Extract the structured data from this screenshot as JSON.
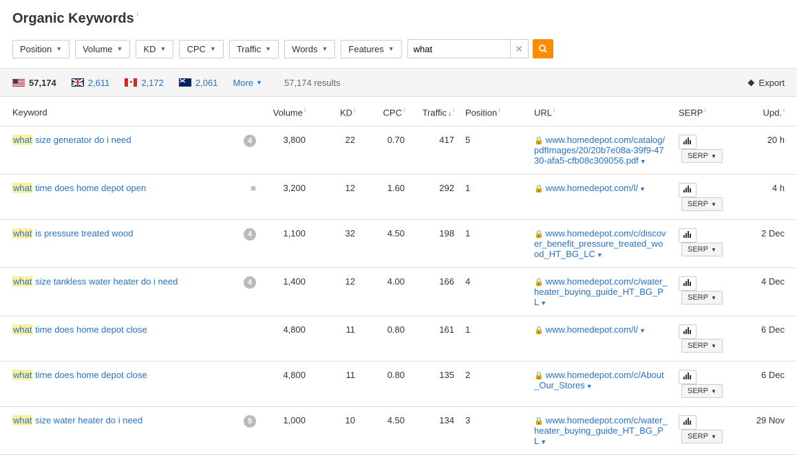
{
  "title": "Organic Keywords",
  "filters": [
    "Position",
    "Volume",
    "KD",
    "CPC",
    "Traffic",
    "Words",
    "Features"
  ],
  "search": {
    "value": "what"
  },
  "countries": [
    {
      "flag": "us",
      "value": "57,174",
      "active": true
    },
    {
      "flag": "gb",
      "value": "2,611"
    },
    {
      "flag": "ca",
      "value": "2,172"
    },
    {
      "flag": "au",
      "value": "2,061"
    }
  ],
  "more_label": "More",
  "results_text": "57,174 results",
  "export_label": "Export",
  "headers": {
    "keyword": "Keyword",
    "volume": "Volume",
    "kd": "KD",
    "cpc": "CPC",
    "traffic": "Traffic",
    "position": "Position",
    "url": "URL",
    "serp": "SERP",
    "upd": "Upd."
  },
  "serp_btn_label": "SERP",
  "rows": [
    {
      "kw_hl": "what",
      "kw_rest": " size generator do i need",
      "feature_type": "badge",
      "feature": "4",
      "volume": "3,800",
      "kd": "22",
      "cpc": "0.70",
      "traffic": "417",
      "position": "5",
      "url": "www.homedepot.com/catalog/pdfImages/20/20b7e08a-39f9-4730-afa5-cfb08c309056.pdf",
      "upd": "20 h"
    },
    {
      "kw_hl": "what",
      "kw_rest": " time does home depot open",
      "feature_type": "video",
      "volume": "3,200",
      "kd": "12",
      "cpc": "1.60",
      "traffic": "292",
      "position": "1",
      "url": "www.homedepot.com/l/",
      "upd": "4 h"
    },
    {
      "kw_hl": "what",
      "kw_rest": " is pressure treated wood",
      "feature_type": "badge",
      "feature": "4",
      "volume": "1,100",
      "kd": "32",
      "cpc": "4.50",
      "traffic": "198",
      "position": "1",
      "url": "www.homedepot.com/c/discover_benefit_pressure_treated_wood_HT_BG_LC",
      "upd": "2 Dec"
    },
    {
      "kw_hl": "what",
      "kw_rest": " size tankless water heater do i need",
      "feature_type": "badge",
      "feature": "4",
      "volume": "1,400",
      "kd": "12",
      "cpc": "4.00",
      "traffic": "166",
      "position": "4",
      "url": "www.homedepot.com/c/water_heater_buying_guide_HT_BG_PL",
      "upd": "4 Dec"
    },
    {
      "kw_hl": "what",
      "kw_rest": " time does home depot close",
      "feature_type": "none",
      "volume": "4,800",
      "kd": "11",
      "cpc": "0.80",
      "traffic": "161",
      "position": "1",
      "url": "www.homedepot.com/l/",
      "upd": "6 Dec"
    },
    {
      "kw_hl": "what",
      "kw_rest": " time does home depot close",
      "feature_type": "none",
      "volume": "4,800",
      "kd": "11",
      "cpc": "0.80",
      "traffic": "135",
      "position": "2",
      "url": "www.homedepot.com/c/About_Our_Stores",
      "upd": "6 Dec"
    },
    {
      "kw_hl": "what",
      "kw_rest": " size water heater do i need",
      "feature_type": "badge",
      "feature": "5",
      "volume": "1,000",
      "kd": "10",
      "cpc": "4.50",
      "traffic": "134",
      "position": "3",
      "url": "www.homedepot.com/c/water_heater_buying_guide_HT_BG_PL",
      "upd": "29 Nov"
    }
  ]
}
